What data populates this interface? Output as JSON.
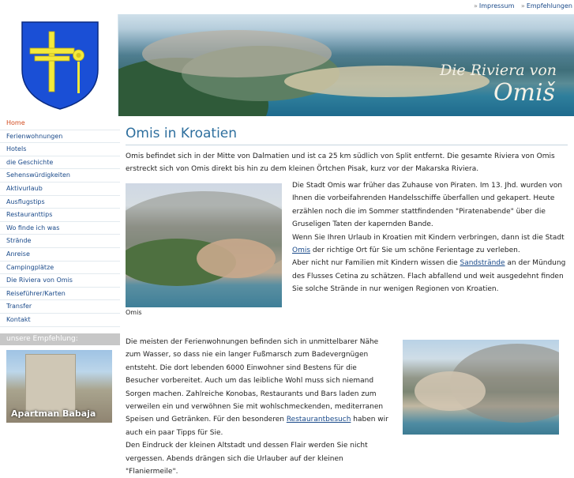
{
  "toplinks": [
    {
      "label": "Impressum"
    },
    {
      "label": "Empfehlungen"
    }
  ],
  "header": {
    "title_line1": "Die Riviera von",
    "title_line2": "Omiš"
  },
  "sidebar": {
    "items": [
      {
        "label": "Home",
        "active": true
      },
      {
        "label": "Ferienwohnungen"
      },
      {
        "label": "Hotels"
      },
      {
        "label": "die Geschichte"
      },
      {
        "label": "Sehenswürdigkeiten"
      },
      {
        "label": "Aktivurlaub"
      },
      {
        "label": "Ausflugstips"
      },
      {
        "label": "Restauranttips"
      },
      {
        "label": "Wo finde ich was"
      },
      {
        "label": "Strände"
      },
      {
        "label": "Anreise"
      },
      {
        "label": "Campingplätze"
      },
      {
        "label": "Die Riviera von Omis"
      },
      {
        "label": "Reiseführer/Karten"
      },
      {
        "label": "Transfer"
      },
      {
        "label": "Kontakt"
      }
    ],
    "recommend_label": "unsere Empfehlung:",
    "recommend_caption": "Apartman Babaja"
  },
  "main": {
    "title": "Omis in Kroatien",
    "intro": "Omis befindet sich in der Mitte von Dalmatien und ist ca 25 km südlich von Split entfernt. Die gesamte Riviera von Omis erstreckt sich von Omis direkt bis hin zu dem kleinen Örtchen Pisak, kurz vor der Makarska Riviera.",
    "image_caption": "Omis",
    "p2_a": "Die Stadt Omis war früher das Zuhause von Piraten. Im 13. Jhd. wurden von Ihnen die vorbeifahrenden Handelsschiffe überfallen und gekapert. Heute erzählen noch die im Sommer stattfindenden \"Piratenabende\" über die Gruseligen Taten der kapernden Bande.",
    "p2_b1": "Wenn Sie Ihren Urlaub in Kroatien mit Kindern verbringen, dann ist die Stadt ",
    "p2_link1": "Omis",
    "p2_b2": " der richtige Ort für Sie um schöne Ferientage zu verleben.",
    "p2_c1": "Aber nicht nur Familien mit Kindern wissen die ",
    "p2_link2": "Sandstrände",
    "p2_c2": " an der Mündung des Flusses Cetina zu schätzen. Flach abfallend und weit ausgedehnt finden Sie solche Strände in nur wenigen Regionen von Kroatien.",
    "p3_a": "Die meisten der Ferienwohnungen befinden sich in unmittelbarer Nähe zum Wasser, so dass nie ein langer Fußmarsch zum Badevergnügen entsteht. Die dort lebenden 6000 Einwohner sind Bestens für die Besucher vorbereitet. Auch um das leibliche Wohl muss sich niemand Sorgen machen. Zahlreiche Konobas, Restaurants und Bars laden zum verweilen ein und verwöhnen Sie mit wohlschmeckenden, mediterranen Speisen und Getränken. Für den besonderen ",
    "p3_link": "Restaurantbesuch",
    "p3_b": " haben wir auch ein paar Tipps für Sie.",
    "p3_c": "Den Eindruck der kleinen Altstadt und dessen Flair werden Sie nicht vergessen. Abends drängen sich die Urlauber auf der kleinen \"Flaniermeile\"."
  },
  "colors": {
    "link": "#1a4a8a",
    "active_nav": "#d24b1e",
    "title": "#2e6f9e",
    "shield_blue": "#1a4fd6",
    "cross_yellow": "#f4e93b"
  }
}
